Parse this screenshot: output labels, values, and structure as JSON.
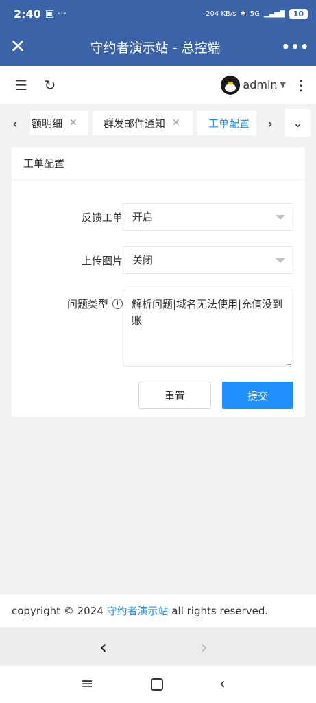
{
  "status": {
    "time": "2:40",
    "speed": "204 KB/s",
    "network": "5G",
    "battery": "10"
  },
  "appbar": {
    "title": "守约者演示站 - 总控端",
    "close_icon": "✕",
    "more_icon": "•••"
  },
  "header": {
    "username": "admin"
  },
  "tabs": [
    {
      "label": "额明细",
      "closable": true
    },
    {
      "label": "群发邮件通知",
      "closable": true
    },
    {
      "label": "工单配置",
      "active": true
    }
  ],
  "card": {
    "title": "工单配置",
    "fields": {
      "feedback": {
        "label": "反馈工单",
        "value": "开启"
      },
      "upload": {
        "label": "上传图片",
        "value": "关闭"
      },
      "types": {
        "label": "问题类型",
        "value": "解析问题|域名无法使用|充值没到账"
      }
    },
    "reset_label": "重置",
    "submit_label": "提交"
  },
  "footer": {
    "prefix": "copyright © 2024 ",
    "site": "守约者演示站",
    "suffix": " all rights reserved."
  },
  "colors": {
    "brand": "#3b64a8",
    "accent": "#1e90ff"
  }
}
